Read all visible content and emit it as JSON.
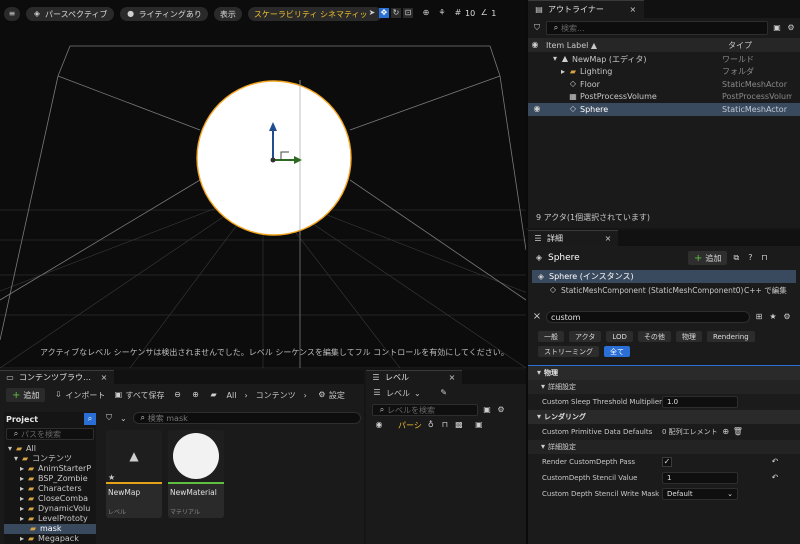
{
  "viewport": {
    "toolbar": {
      "perspective": "パースペクティブ",
      "lighting": "ライティングあり",
      "show": "表示",
      "scalability": "スケーラビリティ シネマティック",
      "grid_value": "10",
      "angle_value": "1"
    },
    "message": "アクティブなレベル シーケンサは検出されませんでした。レベル シーケンスを編集してフル コントロールを有効にしてください。"
  },
  "outliner": {
    "tab_title": "アウトライナー",
    "search_placeholder": "検索...",
    "col_label": "Item Label ▲",
    "col_type": "タイプ",
    "items": [
      {
        "label": "NewMap (エディタ)",
        "type": "ワールド"
      },
      {
        "label": "Lighting",
        "type": "フォルダ"
      },
      {
        "label": "Floor",
        "type": "StaticMeshActor"
      },
      {
        "label": "PostProcessVolume",
        "type": "PostProcessVolum"
      },
      {
        "label": "Sphere",
        "type": "StaticMeshActor"
      }
    ],
    "status": "9 アクタ(1個選択されています)"
  },
  "details": {
    "tab_title": "詳細",
    "object_name": "Sphere",
    "add_label": "追加",
    "instance_label": "Sphere (インスタンス)",
    "component_label": "StaticMeshComponent (StaticMeshComponent0)",
    "cpp_label": "C++ で編集",
    "search_value": "custom",
    "categories": [
      "一般",
      "アクタ",
      "LOD",
      "その他",
      "物理",
      "Rendering",
      "ストリーミング",
      "全て"
    ],
    "sections": {
      "physics": "物理",
      "advanced1": "詳細設定",
      "rendering": "レンダリング",
      "advanced2": "詳細設定"
    },
    "props": {
      "sleep_threshold_label": "Custom Sleep Threshold Multiplier",
      "sleep_threshold_value": "1.0",
      "primitive_data_label": "Custom Primitive Data Defaults",
      "primitive_data_value": "0 配列エレメント",
      "render_depth_label": "Render CustomDepth Pass",
      "stencil_value_label": "CustomDepth Stencil Value",
      "stencil_value": "1",
      "stencil_mask_label": "Custom Depth Stencil Write Mask",
      "stencil_mask_value": "Default"
    }
  },
  "content_browser": {
    "tab_title": "コンテンツブラウ…",
    "add_label": "追加",
    "import_label": "インポート",
    "save_all_label": "すべて保存",
    "path_all": "All",
    "path_content": "コンテンツ",
    "settings_label": "設定",
    "project_label": "Project",
    "path_search_placeholder": "パスを検索",
    "asset_search_placeholder": "検索 mask",
    "tree": [
      "All",
      "コンテンツ",
      "AnimStarterP",
      "BSP_Zombie",
      "Characters",
      "CloseComba",
      "DynamicVolu",
      "LevelPrototy",
      "mask",
      "Megapack"
    ],
    "assets": [
      {
        "name": "NewMap",
        "type": "レベル"
      },
      {
        "name": "NewMaterial",
        "type": "マテリアル"
      }
    ]
  },
  "levels": {
    "tab_title": "レベル",
    "level_label": "レベル",
    "search_placeholder": "レベルを検索",
    "row_name": "パーシ"
  },
  "colors": {
    "accent_blue": "#2a6fd6",
    "scalability_yellow": "#f2c12e",
    "selected_row": "#3a4a5e"
  }
}
